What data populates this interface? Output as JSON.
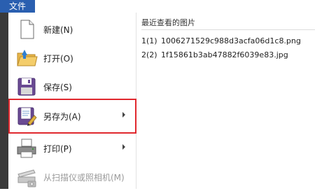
{
  "menu_tab": {
    "label": "文件"
  },
  "menu": {
    "items": [
      {
        "label": "新建(N)",
        "icon": "new-document-icon",
        "enabled": true,
        "submenu": false
      },
      {
        "label": "打开(O)",
        "icon": "open-folder-icon",
        "enabled": true,
        "submenu": false
      },
      {
        "label": "保存(S)",
        "icon": "save-disk-icon",
        "enabled": true,
        "submenu": false
      },
      {
        "label": "另存为(A)",
        "icon": "save-as-icon",
        "enabled": true,
        "submenu": true
      },
      {
        "label": "打印(P)",
        "icon": "printer-icon",
        "enabled": true,
        "submenu": true
      },
      {
        "label": "从扫描仪或照相机(M)",
        "icon": "scanner-icon",
        "enabled": false,
        "submenu": false
      }
    ]
  },
  "recent": {
    "title": "最近查看的图片",
    "items": [
      {
        "num": "1(1)",
        "name": "1006271529c988d3acfa06d1c8.png"
      },
      {
        "num": "2(2)",
        "name": "1f15861b3ab47882f6039e83.jpg"
      }
    ]
  },
  "colors": {
    "file_tab": "#2a5fb0",
    "highlight_border": "#e0282e"
  }
}
